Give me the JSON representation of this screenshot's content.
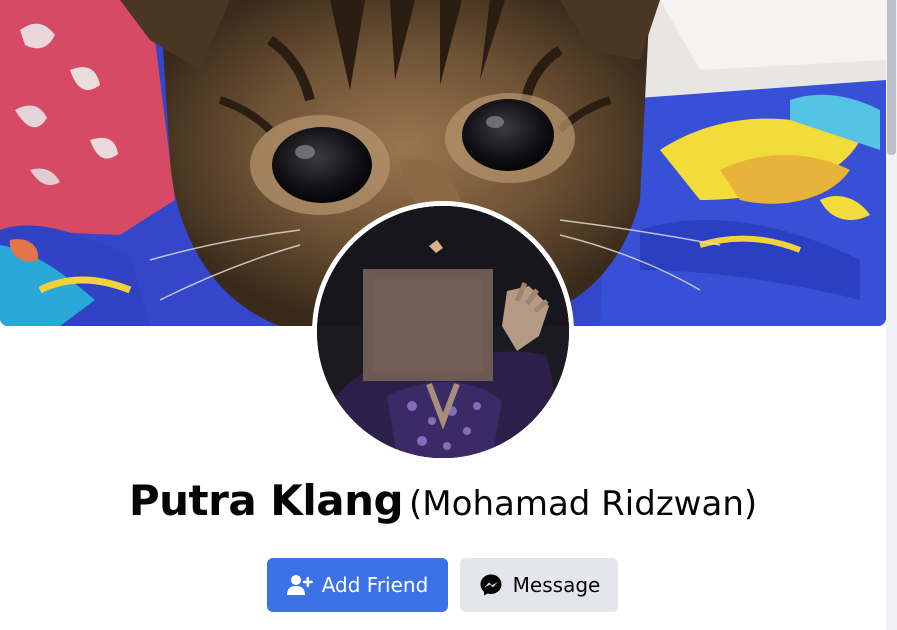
{
  "profile": {
    "name": "Putra Klang",
    "alternate_name": "(Mohamad Ridzwan)"
  },
  "actions": {
    "add_friend_label": "Add Friend",
    "message_label": "Message"
  },
  "icons": {
    "add_friend": "add-friend-icon",
    "messenger": "messenger-icon"
  },
  "colors": {
    "primary_button": "#3b73e6",
    "secondary_button": "#e4e6eb",
    "text": "#050505"
  }
}
